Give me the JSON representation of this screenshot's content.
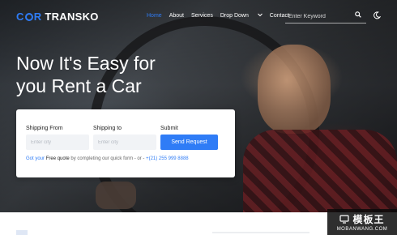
{
  "brand": {
    "logo_c": "C",
    "logo_r": "R",
    "logo_name": "TRANSKO"
  },
  "nav": {
    "items": [
      {
        "label": "Home",
        "active": true
      },
      {
        "label": "About"
      },
      {
        "label": "Services"
      },
      {
        "label": "Drop Down"
      },
      {
        "label": "Contact"
      }
    ],
    "search_placeholder": "Enter Keyword"
  },
  "hero": {
    "line1": "Now It's Easy for",
    "line2": "you Rent a Car"
  },
  "form": {
    "from_label": "Shipping From",
    "to_label": "Shipping to",
    "submit_label": "Submit",
    "from_placeholder": "Enter city",
    "to_placeholder": "Enter city",
    "button": "Send Request",
    "quote_pre": "Got your",
    "quote_bold": "Free quote",
    "quote_mid": "by completing our quick form - or -",
    "phone": "+(21) 255 999 8888"
  },
  "watermark": {
    "title": "模板王",
    "sub": "MOBANWANG.COM"
  },
  "colors": {
    "accent": "#2f7cf6"
  }
}
